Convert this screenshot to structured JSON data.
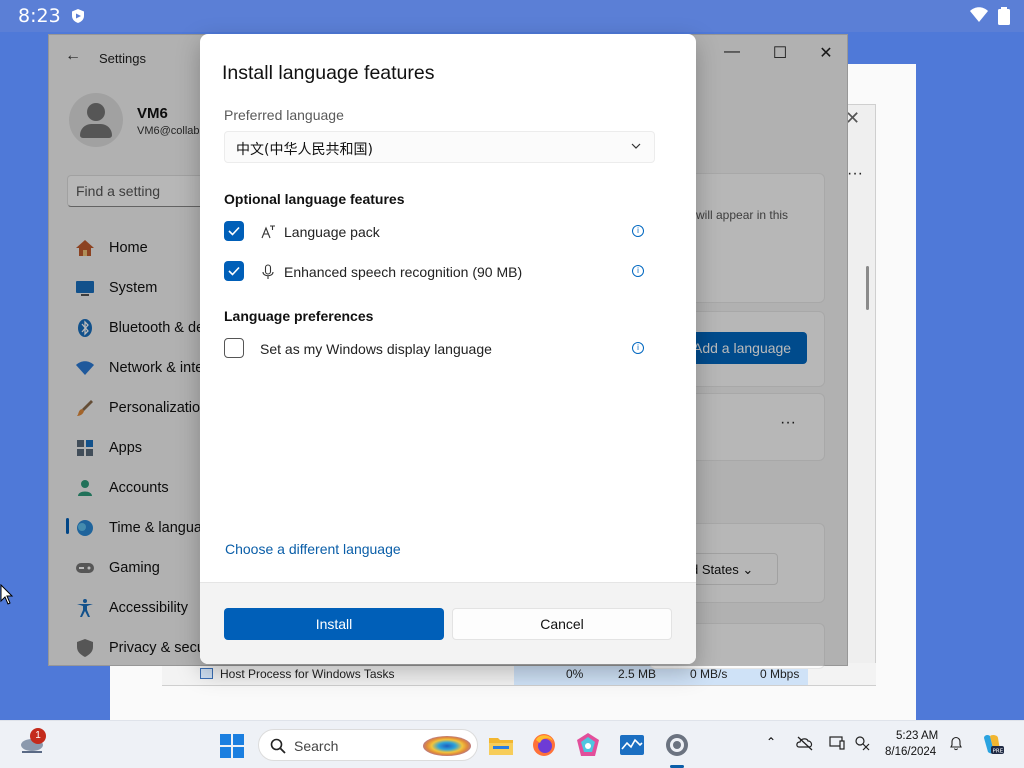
{
  "android": {
    "time": "8:23"
  },
  "task_manager": {
    "row": {
      "name": "Host Process for Windows Tasks",
      "cpu": "0%",
      "memory": "2.5 MB",
      "disk": "0 MB/s",
      "network": "0 Mbps"
    }
  },
  "settings": {
    "title": "Settings",
    "user": {
      "name": "VM6",
      "email": "VM6@collab"
    },
    "search_placeholder": "Find a setting",
    "nav": [
      {
        "label": "Home",
        "icon": "home-icon"
      },
      {
        "label": "System",
        "icon": "system-icon"
      },
      {
        "label": "Bluetooth & de",
        "icon": "bluetooth-icon"
      },
      {
        "label": "Network & inte",
        "icon": "wifi-icon"
      },
      {
        "label": "Personalization",
        "icon": "brush-icon"
      },
      {
        "label": "Apps",
        "icon": "apps-icon"
      },
      {
        "label": "Accounts",
        "icon": "accounts-icon"
      },
      {
        "label": "Time & langua",
        "icon": "globe-clock-icon"
      },
      {
        "label": "Gaming",
        "icon": "gamepad-icon"
      },
      {
        "label": "Accessibility",
        "icon": "accessibility-icon"
      },
      {
        "label": "Privacy & secu",
        "icon": "shield-icon"
      }
    ],
    "active_nav": "Time & langua",
    "content": {
      "info_text": "will appear in this",
      "add_language_label": "Add a language",
      "region_dropdown_value": "d States"
    }
  },
  "dialog": {
    "title": "Install language features",
    "preferred_language_label": "Preferred language",
    "preferred_language_value": "中文(中华人民共和国)",
    "optional_features_heading": "Optional language features",
    "features": [
      {
        "label": "Language pack",
        "checked": true,
        "icon": "language-pack-icon"
      },
      {
        "label": "Enhanced speech recognition (90 MB)",
        "checked": true,
        "icon": "microphone-icon"
      }
    ],
    "preferences_heading": "Language preferences",
    "preferences": [
      {
        "label": "Set as my Windows display language",
        "checked": false
      }
    ],
    "choose_link": "Choose a different language",
    "install_label": "Install",
    "cancel_label": "Cancel"
  },
  "taskbar": {
    "notification_count": "1",
    "search_label": "Search",
    "clock_time": "5:23 AM",
    "clock_date": "8/16/2024",
    "accent": "#005fb8"
  }
}
